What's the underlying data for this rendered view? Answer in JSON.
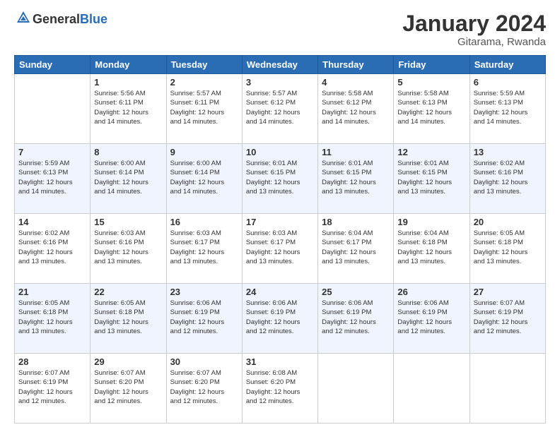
{
  "header": {
    "logo": {
      "general": "General",
      "blue": "Blue"
    },
    "title": "January 2024",
    "location": "Gitarama, Rwanda"
  },
  "days_of_week": [
    "Sunday",
    "Monday",
    "Tuesday",
    "Wednesday",
    "Thursday",
    "Friday",
    "Saturday"
  ],
  "weeks": [
    [
      {
        "day": "",
        "sunrise": "",
        "sunset": "",
        "daylight": ""
      },
      {
        "day": "1",
        "sunrise": "5:56 AM",
        "sunset": "6:11 PM",
        "daylight": "12 hours and 14 minutes."
      },
      {
        "day": "2",
        "sunrise": "5:57 AM",
        "sunset": "6:11 PM",
        "daylight": "12 hours and 14 minutes."
      },
      {
        "day": "3",
        "sunrise": "5:57 AM",
        "sunset": "6:12 PM",
        "daylight": "12 hours and 14 minutes."
      },
      {
        "day": "4",
        "sunrise": "5:58 AM",
        "sunset": "6:12 PM",
        "daylight": "12 hours and 14 minutes."
      },
      {
        "day": "5",
        "sunrise": "5:58 AM",
        "sunset": "6:13 PM",
        "daylight": "12 hours and 14 minutes."
      },
      {
        "day": "6",
        "sunrise": "5:59 AM",
        "sunset": "6:13 PM",
        "daylight": "12 hours and 14 minutes."
      }
    ],
    [
      {
        "day": "7",
        "sunrise": "5:59 AM",
        "sunset": "6:13 PM",
        "daylight": "12 hours and 14 minutes."
      },
      {
        "day": "8",
        "sunrise": "6:00 AM",
        "sunset": "6:14 PM",
        "daylight": "12 hours and 14 minutes."
      },
      {
        "day": "9",
        "sunrise": "6:00 AM",
        "sunset": "6:14 PM",
        "daylight": "12 hours and 14 minutes."
      },
      {
        "day": "10",
        "sunrise": "6:01 AM",
        "sunset": "6:15 PM",
        "daylight": "12 hours and 13 minutes."
      },
      {
        "day": "11",
        "sunrise": "6:01 AM",
        "sunset": "6:15 PM",
        "daylight": "12 hours and 13 minutes."
      },
      {
        "day": "12",
        "sunrise": "6:01 AM",
        "sunset": "6:15 PM",
        "daylight": "12 hours and 13 minutes."
      },
      {
        "day": "13",
        "sunrise": "6:02 AM",
        "sunset": "6:16 PM",
        "daylight": "12 hours and 13 minutes."
      }
    ],
    [
      {
        "day": "14",
        "sunrise": "6:02 AM",
        "sunset": "6:16 PM",
        "daylight": "12 hours and 13 minutes."
      },
      {
        "day": "15",
        "sunrise": "6:03 AM",
        "sunset": "6:16 PM",
        "daylight": "12 hours and 13 minutes."
      },
      {
        "day": "16",
        "sunrise": "6:03 AM",
        "sunset": "6:17 PM",
        "daylight": "12 hours and 13 minutes."
      },
      {
        "day": "17",
        "sunrise": "6:03 AM",
        "sunset": "6:17 PM",
        "daylight": "12 hours and 13 minutes."
      },
      {
        "day": "18",
        "sunrise": "6:04 AM",
        "sunset": "6:17 PM",
        "daylight": "12 hours and 13 minutes."
      },
      {
        "day": "19",
        "sunrise": "6:04 AM",
        "sunset": "6:18 PM",
        "daylight": "12 hours and 13 minutes."
      },
      {
        "day": "20",
        "sunrise": "6:05 AM",
        "sunset": "6:18 PM",
        "daylight": "12 hours and 13 minutes."
      }
    ],
    [
      {
        "day": "21",
        "sunrise": "6:05 AM",
        "sunset": "6:18 PM",
        "daylight": "12 hours and 13 minutes."
      },
      {
        "day": "22",
        "sunrise": "6:05 AM",
        "sunset": "6:18 PM",
        "daylight": "12 hours and 13 minutes."
      },
      {
        "day": "23",
        "sunrise": "6:06 AM",
        "sunset": "6:19 PM",
        "daylight": "12 hours and 12 minutes."
      },
      {
        "day": "24",
        "sunrise": "6:06 AM",
        "sunset": "6:19 PM",
        "daylight": "12 hours and 12 minutes."
      },
      {
        "day": "25",
        "sunrise": "6:06 AM",
        "sunset": "6:19 PM",
        "daylight": "12 hours and 12 minutes."
      },
      {
        "day": "26",
        "sunrise": "6:06 AM",
        "sunset": "6:19 PM",
        "daylight": "12 hours and 12 minutes."
      },
      {
        "day": "27",
        "sunrise": "6:07 AM",
        "sunset": "6:19 PM",
        "daylight": "12 hours and 12 minutes."
      }
    ],
    [
      {
        "day": "28",
        "sunrise": "6:07 AM",
        "sunset": "6:19 PM",
        "daylight": "12 hours and 12 minutes."
      },
      {
        "day": "29",
        "sunrise": "6:07 AM",
        "sunset": "6:20 PM",
        "daylight": "12 hours and 12 minutes."
      },
      {
        "day": "30",
        "sunrise": "6:07 AM",
        "sunset": "6:20 PM",
        "daylight": "12 hours and 12 minutes."
      },
      {
        "day": "31",
        "sunrise": "6:08 AM",
        "sunset": "6:20 PM",
        "daylight": "12 hours and 12 minutes."
      },
      {
        "day": "",
        "sunrise": "",
        "sunset": "",
        "daylight": ""
      },
      {
        "day": "",
        "sunrise": "",
        "sunset": "",
        "daylight": ""
      },
      {
        "day": "",
        "sunrise": "",
        "sunset": "",
        "daylight": ""
      }
    ]
  ],
  "labels": {
    "sunrise_prefix": "Sunrise: ",
    "sunset_prefix": "Sunset: ",
    "daylight_prefix": "Daylight: "
  }
}
